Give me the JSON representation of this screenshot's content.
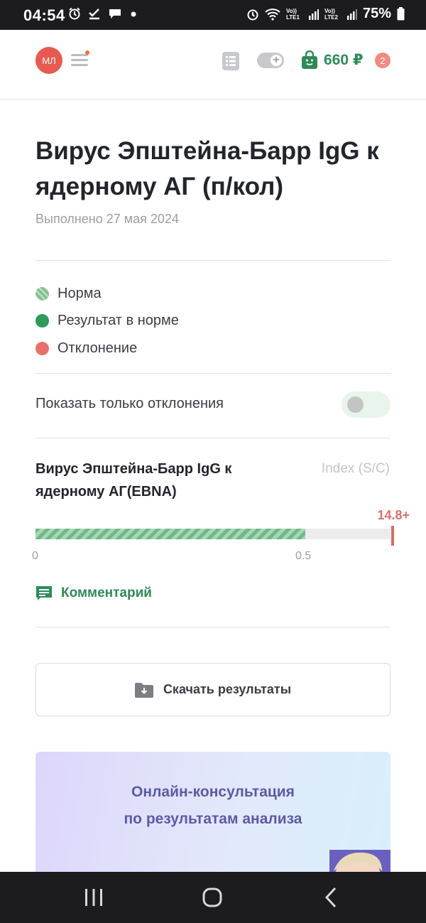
{
  "status_bar": {
    "time": "04:54",
    "battery": "75%",
    "sim1": "Vo)) LTE1",
    "sim2": "Vo)) LTE2",
    "icons": [
      "alarm-icon",
      "check-icon",
      "chat-icon",
      "dot-icon",
      "alarm-icon",
      "wifi-icon",
      "signal-icon",
      "battery-icon"
    ]
  },
  "header": {
    "avatar_initials": "МЛ",
    "balance": "660 ₽",
    "cart_count": "2",
    "colors": {
      "avatar": "#e85a4f",
      "balance": "#2e8b57",
      "badge": "#f08a82"
    }
  },
  "page": {
    "title": "Вирус Эпштейна-Барр IgG к ядерному АГ (п/кол)",
    "completed": "Выполнено 27 мая 2024"
  },
  "legend": {
    "items": [
      {
        "label": "Норма",
        "kind": "norm"
      },
      {
        "label": "Результат в норме",
        "kind": "ok"
      },
      {
        "label": "Отклонение",
        "kind": "deviation"
      }
    ]
  },
  "filter": {
    "label": "Показать только отклонения",
    "enabled": false
  },
  "result": {
    "name": "Вирус Эпштейна-Барр IgG к ядерному АГ(EBNA)",
    "unit": "Index (S/C)",
    "value": "14.8+",
    "range_min": "0",
    "range_max": "0.5",
    "norm_fraction": 0.76,
    "comment_label": "Комментарий"
  },
  "download": {
    "label": "Скачать результаты"
  },
  "consult": {
    "line1": "Онлайн-консультация",
    "line2": "по результатам анализа"
  },
  "nav": {
    "buttons": [
      "recent-apps-icon",
      "home-icon",
      "back-icon"
    ]
  }
}
